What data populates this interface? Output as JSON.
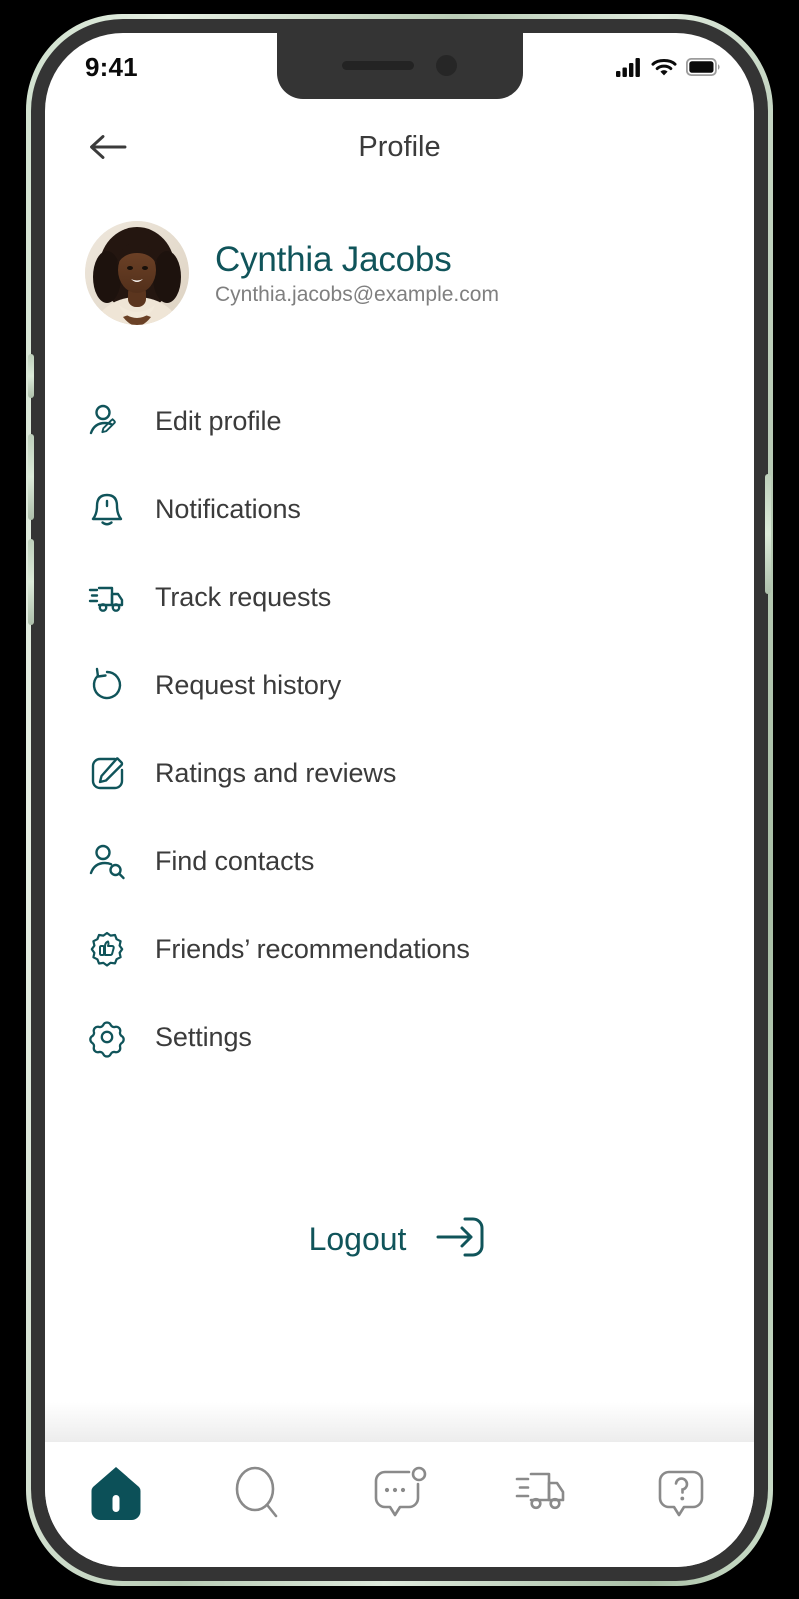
{
  "device": {
    "frame_color": "#c6d9c3",
    "bezel_color": "#343434"
  },
  "status_bar": {
    "time": "9:41",
    "icons": [
      "signal-icon",
      "wifi-icon",
      "battery-icon"
    ]
  },
  "header": {
    "back_icon": "arrow-left-icon",
    "title": "Profile"
  },
  "profile": {
    "avatar_alt": "Cynthia Jacobs profile photo",
    "name": "Cynthia Jacobs",
    "email": "Cynthia.jacobs@example.com"
  },
  "menu": {
    "items": [
      {
        "label": "Edit profile",
        "icon": "user-edit-icon"
      },
      {
        "label": "Notifications",
        "icon": "bell-icon"
      },
      {
        "label": "Track requests",
        "icon": "delivery-truck-icon"
      },
      {
        "label": "Request history",
        "icon": "history-rotate-icon"
      },
      {
        "label": "Ratings and reviews",
        "icon": "square-pencil-icon"
      },
      {
        "label": "Find contacts",
        "icon": "user-search-icon"
      },
      {
        "label": "Friends’ recommendations",
        "icon": "badge-thumbs-up-icon"
      },
      {
        "label": "Settings",
        "icon": "gear-icon"
      }
    ]
  },
  "logout": {
    "label": "Logout",
    "icon": "logout-arrow-icon"
  },
  "bottom_nav": {
    "items": [
      {
        "name": "home",
        "icon": "home-icon",
        "active": true
      },
      {
        "name": "search",
        "icon": "search-icon",
        "active": false
      },
      {
        "name": "messages",
        "icon": "chat-bubble-icon",
        "active": false
      },
      {
        "name": "delivery",
        "icon": "truck-icon",
        "active": false
      },
      {
        "name": "help",
        "icon": "help-bubble-icon",
        "active": false
      }
    ]
  },
  "colors": {
    "accent_teal": "#10545a",
    "text_dark": "#3b3b3b",
    "text_muted": "#7f7f7f",
    "nav_inactive": "#8a8a8a"
  }
}
